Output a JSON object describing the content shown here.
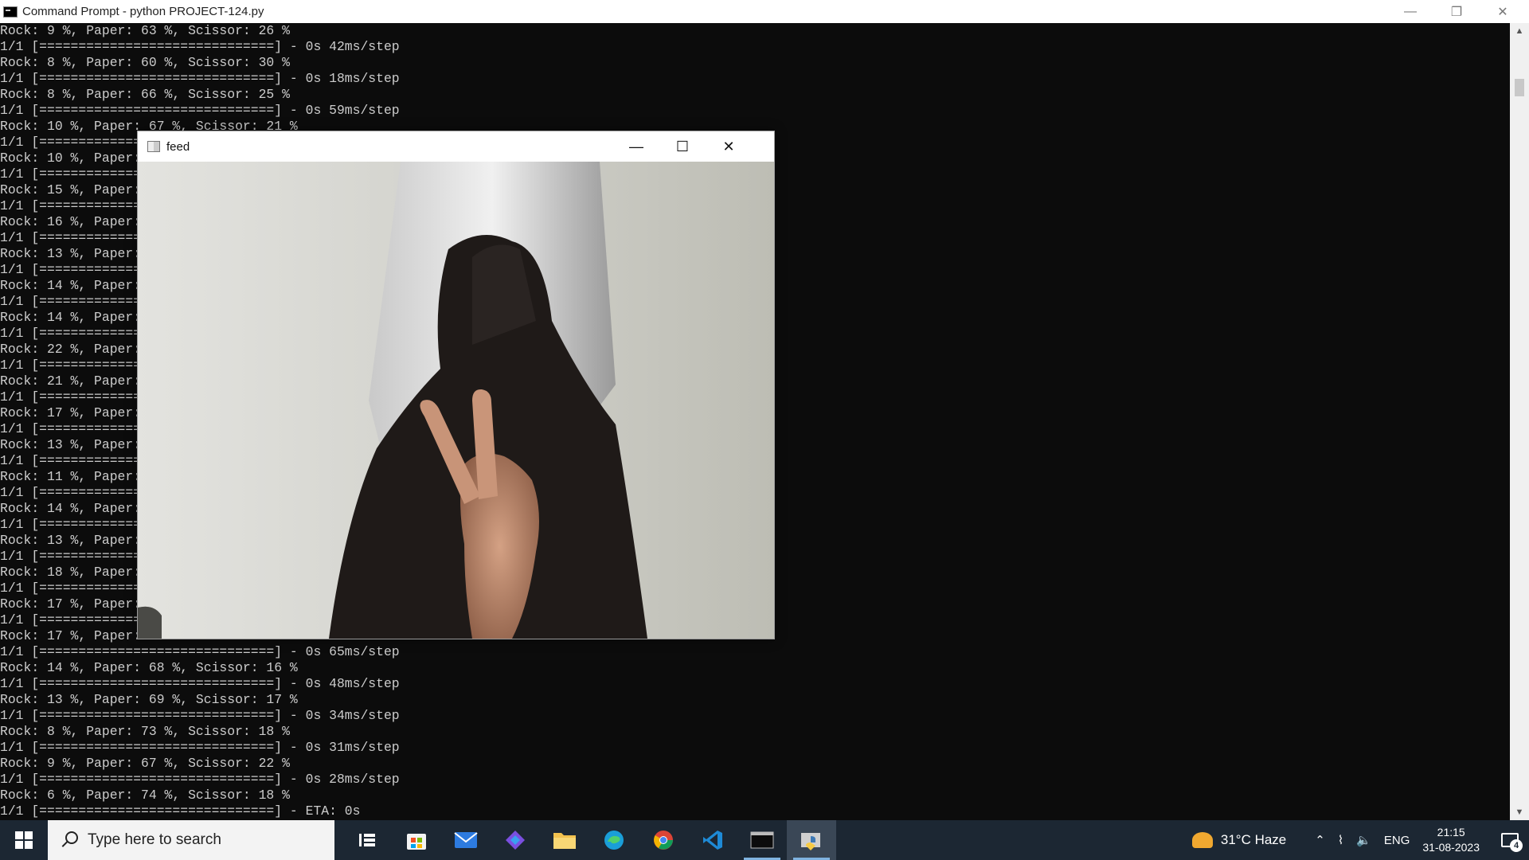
{
  "window": {
    "title": "Command Prompt - python  PROJECT-124.py",
    "controls": [
      "minimize",
      "restore",
      "close"
    ]
  },
  "console": {
    "top_lines": [
      "Rock: 9 %, Paper: 63 %, Scissor: 26 %",
      "1/1 [==============================] - 0s 42ms/step",
      "Rock: 8 %, Paper: 60 %, Scissor: 30 %",
      "1/1 [==============================] - 0s 18ms/step",
      "Rock: 8 %, Paper: 66 %, Scissor: 25 %",
      "1/1 [==============================] - 0s 59ms/step",
      "Rock: 10 %, Paper: 67 %, Scissor: 21 %",
      "1/1 [==============",
      "Rock: 10 %, Paper:",
      "1/1 [==============",
      "Rock: 15 %, Paper:",
      "1/1 [==============",
      "Rock: 16 %, Paper:",
      "1/1 [==============",
      "Rock: 13 %, Paper:",
      "1/1 [==============",
      "Rock: 14 %, Paper:",
      "1/1 [==============",
      "Rock: 14 %, Paper:",
      "1/1 [==============",
      "Rock: 22 %, Paper:",
      "1/1 [==============",
      "Rock: 21 %, Paper:",
      "1/1 [==============",
      "Rock: 17 %, Paper:",
      "1/1 [==============",
      "Rock: 13 %, Paper:",
      "1/1 [==============",
      "Rock: 11 %, Paper:",
      "1/1 [==============",
      "Rock: 14 %, Paper:",
      "1/1 [==============",
      "Rock: 13 %, Paper:",
      "1/1 [==============",
      "Rock: 18 %, Paper:",
      "1/1 [==============",
      "Rock: 17 %, Paper:",
      "1/1 [==============",
      "Rock: 17 %, Paper:",
      "1/1 [==============================] - 0s 65ms/step",
      "Rock: 14 %, Paper: 68 %, Scissor: 16 %",
      "1/1 [==============================] - 0s 48ms/step",
      "Rock: 13 %, Paper: 69 %, Scissor: 17 %",
      "1/1 [==============================] - 0s 34ms/step",
      "Rock: 8 %, Paper: 73 %, Scissor: 18 %",
      "1/1 [==============================] - 0s 31ms/step",
      "Rock: 9 %, Paper: 67 %, Scissor: 22 %",
      "1/1 [==============================] - 0s 28ms/step",
      "Rock: 6 %, Paper: 74 %, Scissor: 18 %",
      "1/1 [==============================] - ETA: 0s"
    ]
  },
  "feed_window": {
    "title": "feed",
    "controls": [
      "minimize",
      "maximize",
      "close"
    ]
  },
  "taskbar": {
    "search_placeholder": "Type here to search",
    "apps": [
      "task-view",
      "microsoft-store",
      "mail",
      "copilot",
      "file-explorer",
      "edge",
      "chrome",
      "vscode",
      "terminal",
      "python"
    ],
    "weather": "31°C  Haze",
    "language": "ENG",
    "time": "21:15",
    "date": "31-08-2023",
    "notification_count": "4"
  },
  "colors": {
    "console_bg": "#0c0c0c",
    "console_fg": "#cccccc",
    "taskbar_bg": "#1c2733"
  }
}
